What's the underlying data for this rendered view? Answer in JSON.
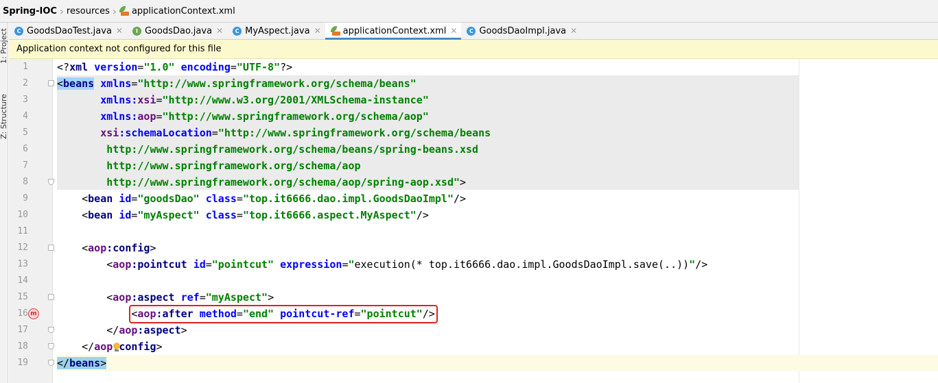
{
  "breadcrumb": {
    "project": "Spring-IOC",
    "folder": "resources",
    "file": "applicationContext.xml"
  },
  "toolwindows": {
    "project": "1: Project",
    "structure": "Z: Structure"
  },
  "tabs": [
    {
      "label": "GoodsDaoTest.java",
      "icon": "class-c-icon",
      "color": "#3a96dd"
    },
    {
      "label": "GoodsDao.java",
      "icon": "interface-i-icon",
      "color": "#6aa84f"
    },
    {
      "label": "MyAspect.java",
      "icon": "class-c-icon",
      "color": "#3a96dd"
    },
    {
      "label": "applicationContext.xml",
      "icon": "xml-file-icon",
      "active": true
    },
    {
      "label": "GoodsDaoImpl.java",
      "icon": "class-c-icon",
      "color": "#3a96dd"
    }
  ],
  "banner": {
    "text": "Application context not configured for this file"
  },
  "line_numbers": [
    "1",
    "2",
    "3",
    "4",
    "5",
    "6",
    "7",
    "8",
    "9",
    "10",
    "11",
    "12",
    "13",
    "14",
    "15",
    "16",
    "17",
    "18",
    "19"
  ],
  "code": {
    "l1": {
      "a": "<?",
      "b": "xml ",
      "c": "version",
      "d": "=",
      "e": "\"1.0\"",
      "f": " ",
      "g": "encoding",
      "h": "=",
      "i": "\"UTF-8\"",
      "j": "?>"
    },
    "l2": {
      "a": "<",
      "b": "beans",
      "c": " ",
      "d": "xmlns",
      "e": "=",
      "f": "\"http://www.springframework.org/schema/beans\""
    },
    "l3": {
      "indent": "       ",
      "ns": "xmlns",
      "colon": ":",
      "attr": "xsi",
      "eq": "=",
      "val": "\"http://www.w3.org/2001/XMLSchema-instance\""
    },
    "l4": {
      "indent": "       ",
      "ns": "xmlns",
      "colon": ":",
      "attr": "aop",
      "eq": "=",
      "val": "\"http://www.springframework.org/schema/aop\""
    },
    "l5": {
      "indent": "       ",
      "ns": "xsi",
      "colon": ":",
      "attr": "schemaLocation",
      "eq": "=",
      "val": "\"http://www.springframework.org/schema/beans"
    },
    "l6": {
      "val": "        http://www.springframework.org/schema/beans/spring-beans.xsd"
    },
    "l7": {
      "val": "        http://www.springframework.org/schema/aop"
    },
    "l8": {
      "val": "        http://www.springframework.org/schema/aop/spring-aop.xsd\"",
      "end": ">"
    },
    "l9": {
      "indent": "    ",
      "open": "<",
      "tag": "bean",
      "sp1": " ",
      "a1": "id",
      "eq1": "=",
      "v1": "\"goodsDao\"",
      "sp2": " ",
      "a2": "class",
      "eq2": "=",
      "v2": "\"top.it6666.dao.impl.GoodsDaoImpl\"",
      "close": "/>"
    },
    "l10": {
      "indent": "    ",
      "open": "<",
      "tag": "bean",
      "sp1": " ",
      "a1": "id",
      "eq1": "=",
      "v1": "\"myAspect\"",
      "sp2": " ",
      "a2": "class",
      "eq2": "=",
      "v2": "\"top.it6666.aspect.MyAspect\"",
      "close": "/>"
    },
    "l12": {
      "indent": "    ",
      "open": "<",
      "ns": "aop",
      "colon": ":",
      "tag": "config",
      "close": ">"
    },
    "l13": {
      "indent": "        ",
      "open": "<",
      "ns": "aop",
      "colon": ":",
      "tag": "pointcut",
      "sp1": " ",
      "a1": "id",
      "eq1": "=",
      "v1": "\"pointcut\"",
      "sp2": " ",
      "a2": "expression",
      "eq2": "=",
      "q1": "\"",
      "fn": "execution(* top.it6666.dao.impl.GoodsDaoImpl.save(..))",
      "q2": "\"",
      "close": "/>"
    },
    "l15": {
      "indent": "        ",
      "open": "<",
      "ns": "aop",
      "colon": ":",
      "tag": "aspect",
      "sp1": " ",
      "a1": "ref",
      "eq1": "=",
      "v1": "\"myAspect\"",
      "close": ">"
    },
    "l16": {
      "indent": "            ",
      "open": "<",
      "ns": "aop",
      "colon": ":",
      "tag": "after",
      "sp1": " ",
      "a1": "method",
      "eq1": "=",
      "v1": "\"end\"",
      "sp2": " ",
      "a2": "pointcut-ref",
      "eq2": "=",
      "v2": "\"pointcut\"",
      "close": "/>"
    },
    "l17": {
      "indent": "        ",
      "open": "</",
      "ns": "aop",
      "colon": ":",
      "tag": "aspect",
      "close": ">"
    },
    "l18": {
      "indent": "    ",
      "open": "</",
      "ns": "aop",
      "colon": ":",
      "tag": "config",
      "close": ">"
    },
    "l19": {
      "open": "</",
      "tag": "beans",
      "close": ">"
    }
  },
  "gutter_markers": {
    "line16": "method-m-icon",
    "line18": "lightbulb-icon"
  },
  "colors": {
    "tag": "#000080",
    "attribute": "#0000ff",
    "namespace": "#660e7a",
    "value": "#008000",
    "highlight_box": "#e02020",
    "tab_underline": "#4a88c7",
    "banner_bg": "#fdf9cf"
  }
}
